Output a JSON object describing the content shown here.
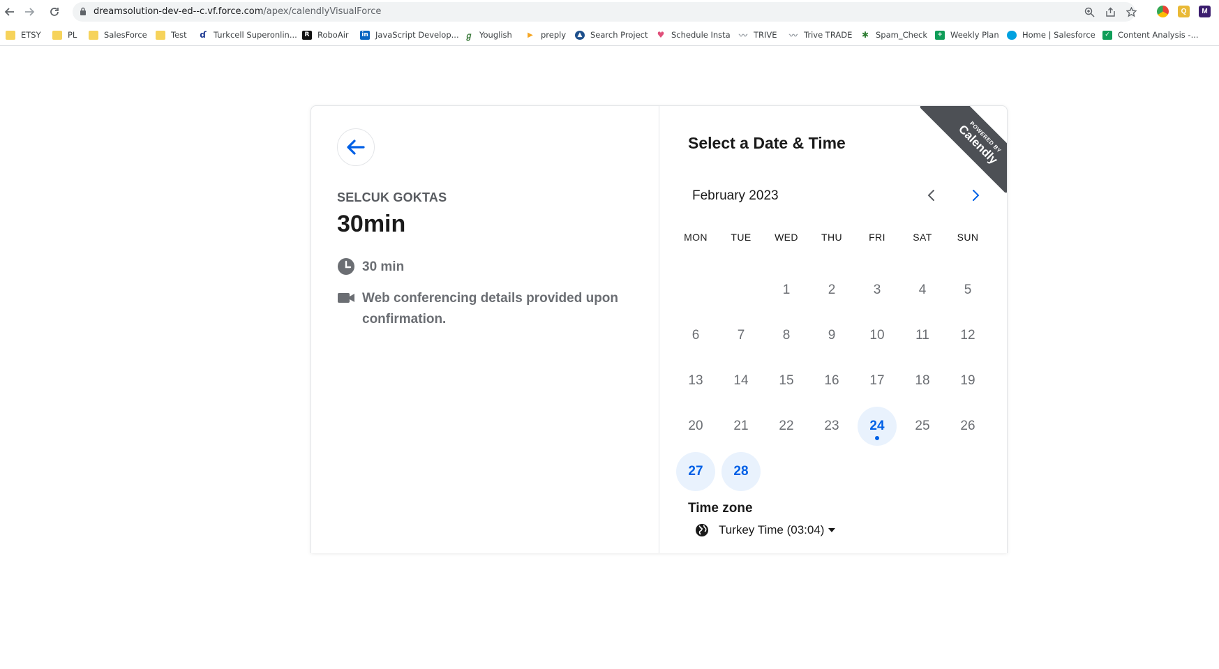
{
  "browser": {
    "url_host": "dreamsolution-dev-ed--c.vf.force.com",
    "url_path": "/apex/calendlyVisualForce"
  },
  "bookmarks": [
    {
      "label": "ETSY",
      "icon": "folder-icon"
    },
    {
      "label": "PL",
      "icon": "folder-icon"
    },
    {
      "label": "SalesForce",
      "icon": "folder-icon"
    },
    {
      "label": "Test",
      "icon": "folder-icon"
    },
    {
      "label": "Turkcell Superonlin...",
      "icon": "turkcell-icon"
    },
    {
      "label": "RoboAir",
      "icon": "roboair-icon"
    },
    {
      "label": "JavaScript Develop...",
      "icon": "linkedin-icon"
    },
    {
      "label": "Youglish",
      "icon": "youglish-icon"
    },
    {
      "label": "preply",
      "icon": "preply-icon"
    },
    {
      "label": "Search Project",
      "icon": "search-project-icon"
    },
    {
      "label": "Schedule Insta",
      "icon": "heart-icon"
    },
    {
      "label": "TRIVE",
      "icon": "trive-icon"
    },
    {
      "label": "Trive TRADE",
      "icon": "trive-icon"
    },
    {
      "label": "Spam_Check",
      "icon": "palm-icon"
    },
    {
      "label": "Weekly Plan",
      "icon": "sheets-icon"
    },
    {
      "label": "Home | Salesforce",
      "icon": "salesforce-icon"
    },
    {
      "label": "Content Analysis -...",
      "icon": "checkbox-icon"
    }
  ],
  "event": {
    "host": "SELCUK GOKTAS",
    "name": "30min",
    "duration": "30 min",
    "location": "Web conferencing details provided upon confirmation."
  },
  "scheduler": {
    "title": "Select a Date & Time",
    "month": "February 2023",
    "weekdays": [
      "MON",
      "TUE",
      "WED",
      "THU",
      "FRI",
      "SAT",
      "SUN"
    ],
    "days": [
      "1",
      "2",
      "3",
      "4",
      "5",
      "6",
      "7",
      "8",
      "9",
      "10",
      "11",
      "12",
      "13",
      "14",
      "15",
      "16",
      "17",
      "18",
      "19",
      "20",
      "21",
      "22",
      "23",
      "24",
      "25",
      "26",
      "27",
      "28"
    ],
    "available_days": [
      "24",
      "27",
      "28"
    ],
    "today": "24",
    "timezone_label": "Time zone",
    "timezone_value": "Turkey Time (03:04)"
  },
  "ribbon": {
    "line1": "POWERED BY",
    "line2": "Calendly"
  },
  "colors": {
    "accent": "#0060e6",
    "available_bg": "#e9f2fd",
    "ribbon_bg": "#4d5055"
  }
}
